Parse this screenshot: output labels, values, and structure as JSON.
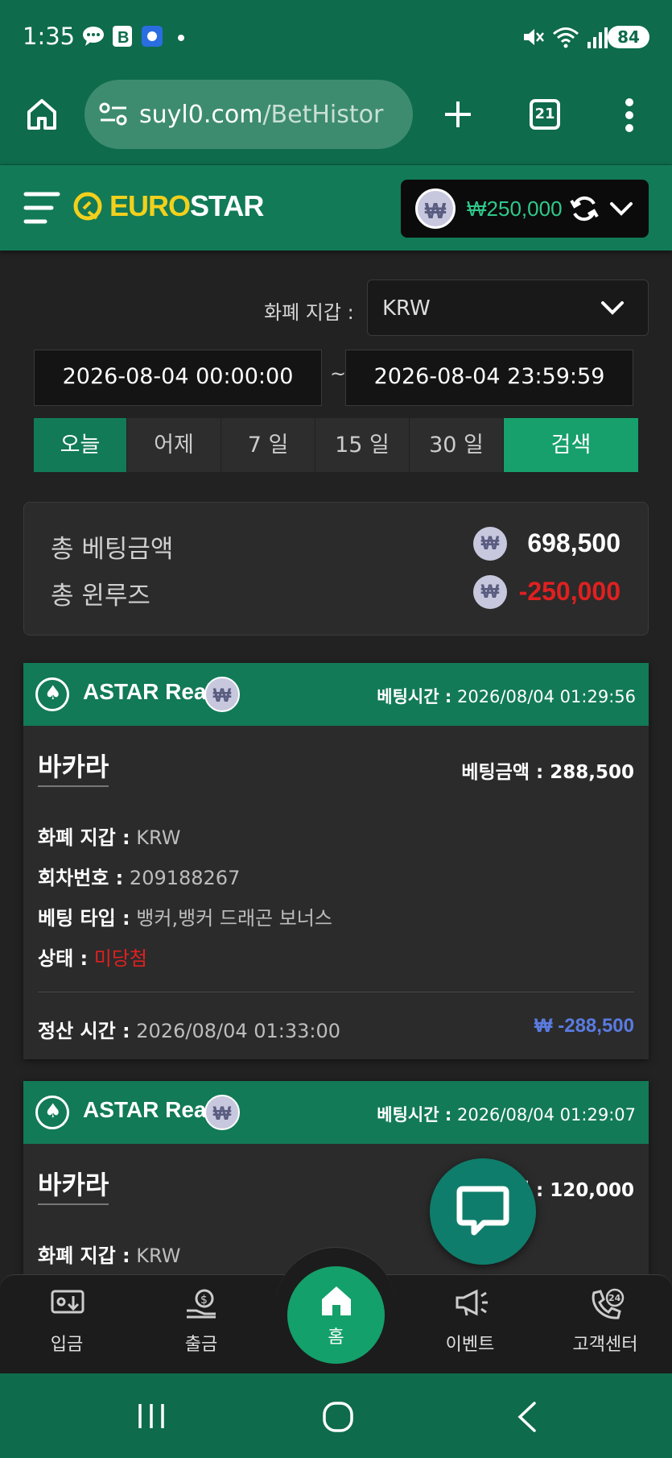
{
  "status_bar": {
    "time": "1:35",
    "battery": "84"
  },
  "browser": {
    "url_main": "suyl0.com",
    "url_rest": "/BetHistor",
    "tab_count": "21"
  },
  "site": {
    "logo_part1": "EURO",
    "logo_part2": "STAR",
    "balance": "₩250,000",
    "won_symbol": "₩"
  },
  "filters": {
    "wallet_label": "화폐 지갑 :",
    "wallet_value": "KRW",
    "date_from": "2026-08-04 00:00:00",
    "date_sep": "~",
    "date_to": "2026-08-04 23:59:59",
    "tabs": [
      "오늘",
      "어제",
      "7 일",
      "15 일",
      "30 일"
    ],
    "search_label": "검색"
  },
  "summary": {
    "total_bet_label": "총 베팅금액",
    "total_bet_value": "698,500",
    "total_winloss_label": "총 윈루즈",
    "total_winloss_value": "-250,000"
  },
  "bets": [
    {
      "provider": "ASTAR Real",
      "bet_time_label": "베팅시간 :",
      "bet_time": "2026/08/04 01:29:56",
      "game": "바카라",
      "bet_amount_label": "베팅금액 :",
      "bet_amount": "288,500",
      "wallet_label": "화폐 지갑 :",
      "wallet": "KRW",
      "round_label": "회차번호 :",
      "round": "209188267",
      "bet_type_label": "베팅 타입 :",
      "bet_type": "뱅커,뱅커 드래곤 보너스",
      "status_label": "상태 :",
      "status": "미당첨",
      "settle_label": "정산 시간 :",
      "settle_time": "2026/08/04 01:33:00",
      "payout": "₩ -288,500"
    },
    {
      "provider": "ASTAR Real",
      "bet_time_label": "베팅시간 :",
      "bet_time": "2026/08/04 01:29:07",
      "game": "바카라",
      "bet_amount_label": "액 :",
      "bet_amount": "120,000",
      "wallet_label": "화폐 지갑 :",
      "wallet": "KRW"
    }
  ],
  "bottom_nav": {
    "deposit": "입금",
    "withdraw": "출금",
    "home": "홈",
    "event": "이벤트",
    "support": "고객센터"
  },
  "colors": {
    "brand_green": "#127a57",
    "accent_green": "#17a06c",
    "loss_red": "#e02020",
    "payout_blue": "#5a7be0",
    "logo_yellow": "#f2d01c"
  }
}
